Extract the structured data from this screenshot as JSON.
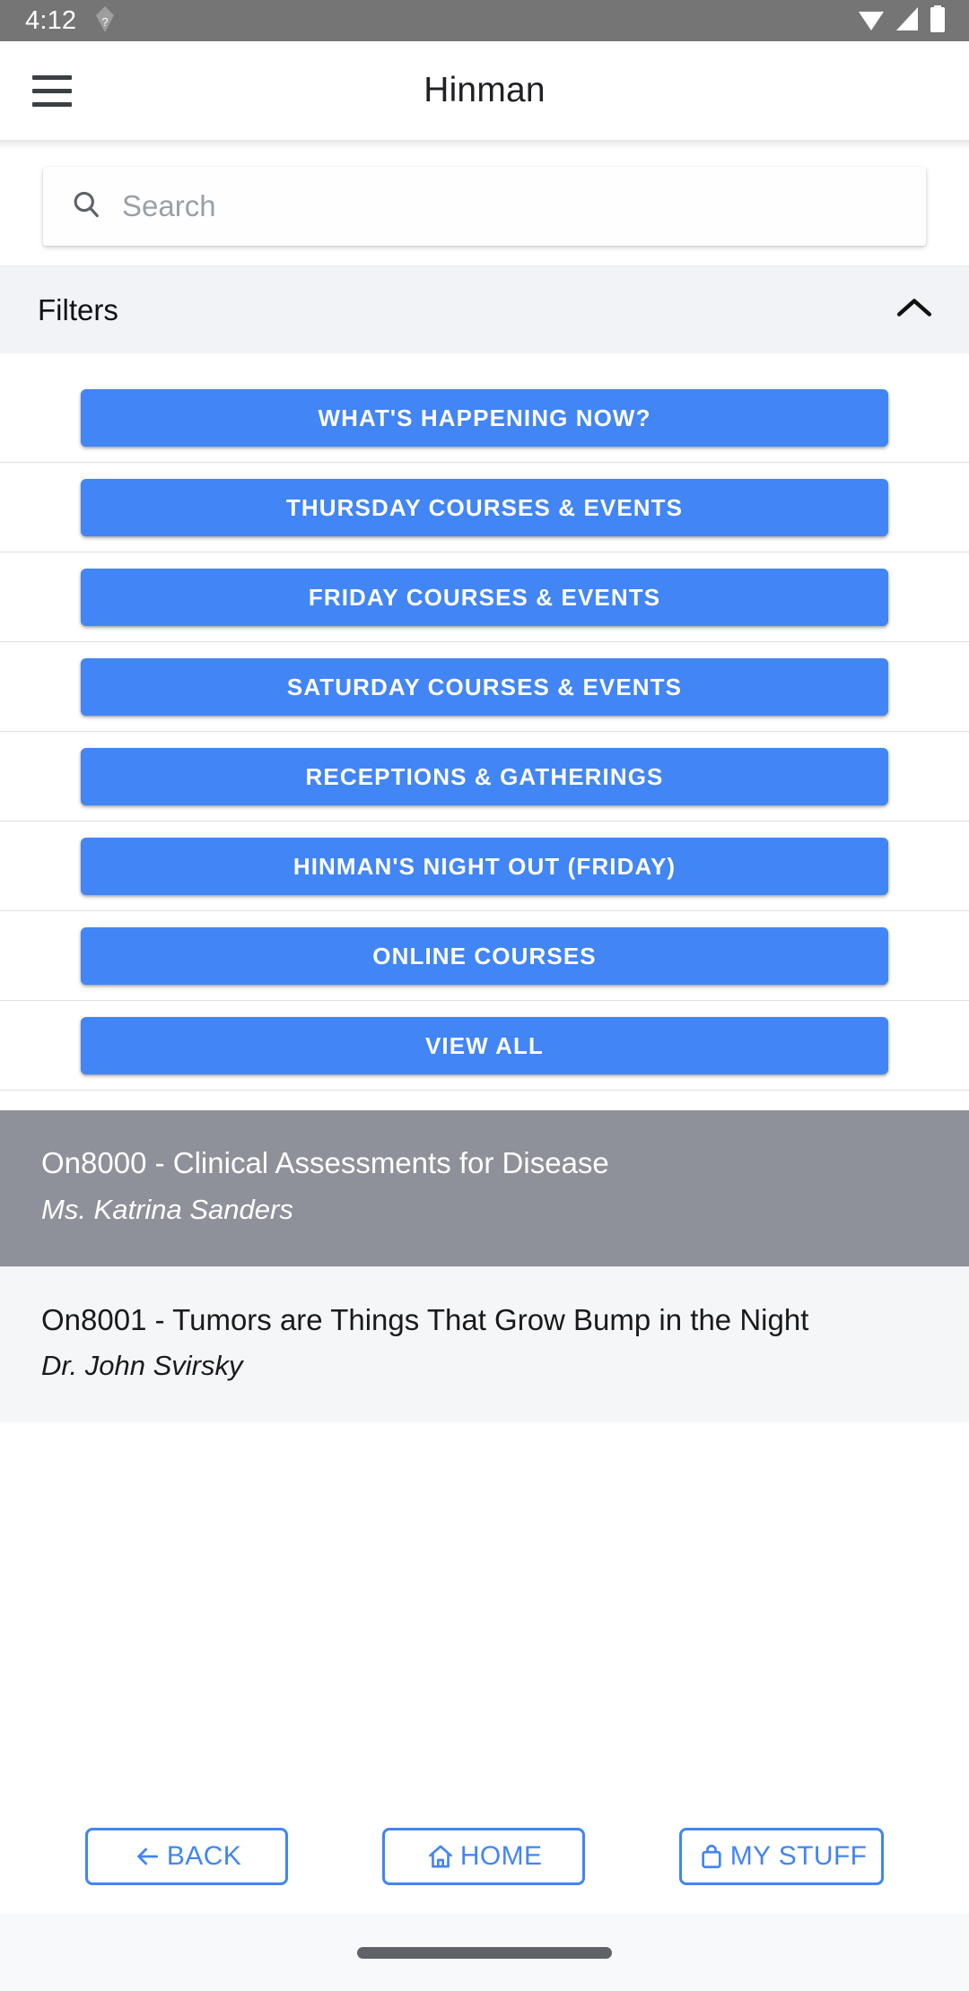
{
  "status_bar": {
    "time": "4:12",
    "icons": [
      "no-sim-icon",
      "wifi-icon",
      "signal-icon",
      "battery-icon"
    ]
  },
  "app_bar": {
    "menu_icon": "hamburger-menu-icon",
    "title": "Hinman"
  },
  "search": {
    "icon": "search-icon",
    "value": "",
    "placeholder": "Search"
  },
  "filters": {
    "label": "Filters",
    "toggle_icon": "chevron-up-icon",
    "expanded": true,
    "buttons": [
      {
        "label": "What's Happening Now?"
      },
      {
        "label": "Thursday Courses & Events"
      },
      {
        "label": "Friday Courses & Events"
      },
      {
        "label": "Saturday Courses & Events"
      },
      {
        "label": "Receptions & Gatherings"
      },
      {
        "label": "Hinman's Night Out (Friday)"
      },
      {
        "label": "Online Courses"
      },
      {
        "label": "View All"
      }
    ]
  },
  "results": [
    {
      "title": "On8000 - Clinical Assessments for Disease",
      "presenter": "Ms. Katrina Sanders",
      "selected": true
    },
    {
      "title": "On8001 - Tumors are Things That Grow Bump in the Night",
      "presenter": "Dr. John Svirsky",
      "selected": false
    }
  ],
  "bottom_nav": [
    {
      "label": "BACK",
      "icon": "arrow-left-icon"
    },
    {
      "label": "HOME",
      "icon": "home-icon"
    },
    {
      "label": "MY STUFF",
      "icon": "bag-icon"
    }
  ],
  "colors": {
    "accent": "#4285f4",
    "status_bar": "#757575",
    "selected_row": "#8e9199",
    "filters_bar": "#f1f3f6"
  }
}
